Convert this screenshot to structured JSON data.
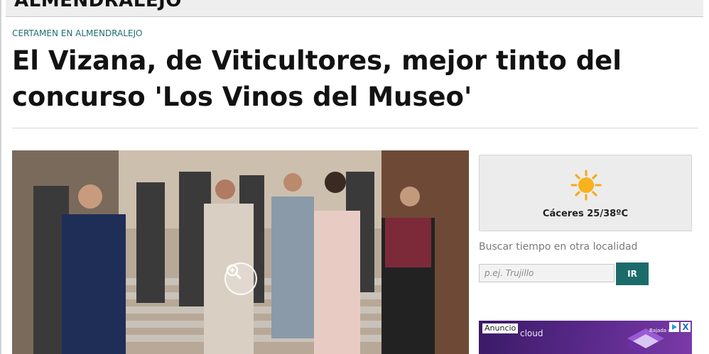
{
  "section": {
    "title": "ALMENDRALEJO"
  },
  "article": {
    "kicker": "CERTAMEN EN ALMENDRALEJO",
    "headline": "El Vizana, de Viticultores, mejor tinto del concurso 'Los Vinos del Museo'"
  },
  "weather": {
    "location_temp": "Cáceres 25/38ºC",
    "icon": "sun-icon",
    "search_label": "Buscar tiempo en otra localidad",
    "search_placeholder": "p.ej. Trujillo",
    "search_value": "",
    "go_label": "IR"
  },
  "ad": {
    "badge": "Anuncio",
    "brand": "cloud",
    "cta": "Bajada de...",
    "close_label": "X"
  },
  "colors": {
    "accent": "#1c6b6b",
    "kicker": "#1f6f73",
    "ad_background": "#5c2a8c"
  }
}
